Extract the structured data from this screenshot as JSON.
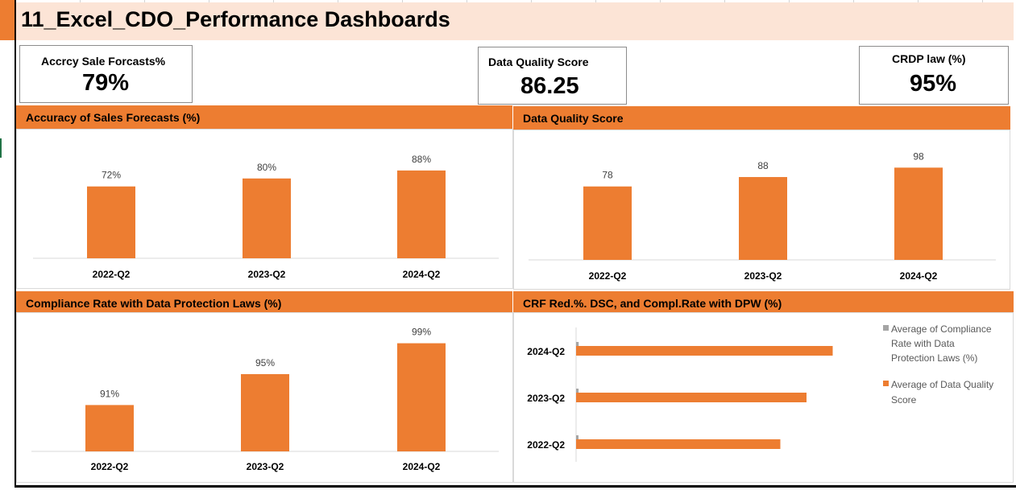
{
  "title": "11_Excel_CDO_Performance Dashboards",
  "kpis": {
    "accuracy": {
      "label": "Accrcy Sale Forcasts%",
      "value": "79%"
    },
    "quality": {
      "label": "Data Quality Score",
      "value": "86.25"
    },
    "crdp": {
      "label": "CRDP law (%)",
      "value": "95%"
    }
  },
  "colors": {
    "accent": "#ed7d31",
    "header_bg": "#fce4d6",
    "secondary": "#a5a5a5",
    "axis": "#d9d9d9"
  },
  "chart_data": [
    {
      "type": "bar",
      "title": "Accuracy of Sales Forecasts (%)",
      "categories": [
        "2022-Q2",
        "2023-Q2",
        "2024-Q2"
      ],
      "values": [
        72,
        80,
        88
      ],
      "labels": [
        "72%",
        "80%",
        "88%"
      ],
      "ylim": [
        0,
        100
      ]
    },
    {
      "type": "bar",
      "title": "Data Quality Score",
      "categories": [
        "2022-Q2",
        "2023-Q2",
        "2024-Q2"
      ],
      "values": [
        78,
        88,
        98
      ],
      "labels": [
        "78",
        "88",
        "98"
      ],
      "ylim": [
        0,
        100
      ]
    },
    {
      "type": "bar",
      "title": "Compliance Rate with Data Protection Laws (%)",
      "categories": [
        "2022-Q2",
        "2023-Q2",
        "2024-Q2"
      ],
      "values": [
        91,
        95,
        99
      ],
      "labels": [
        "91%",
        "95%",
        "99%"
      ],
      "ylim": [
        85,
        100
      ]
    },
    {
      "type": "bar",
      "orientation": "horizontal",
      "title": "CRF Red.%. DSC, and Compl.Rate with DPW (%)",
      "categories": [
        "2024-Q2",
        "2023-Q2",
        "2022-Q2"
      ],
      "series": [
        {
          "name": "Average of Compliance Rate with Data Protection Laws (%)",
          "values": [
            0.99,
            0.95,
            0.91
          ],
          "color": "#a5a5a5"
        },
        {
          "name": "Average of Data Quality Score",
          "values": [
            98,
            88,
            78
          ],
          "color": "#ed7d31"
        }
      ],
      "xlim": [
        0,
        100
      ],
      "legend": "right"
    }
  ]
}
